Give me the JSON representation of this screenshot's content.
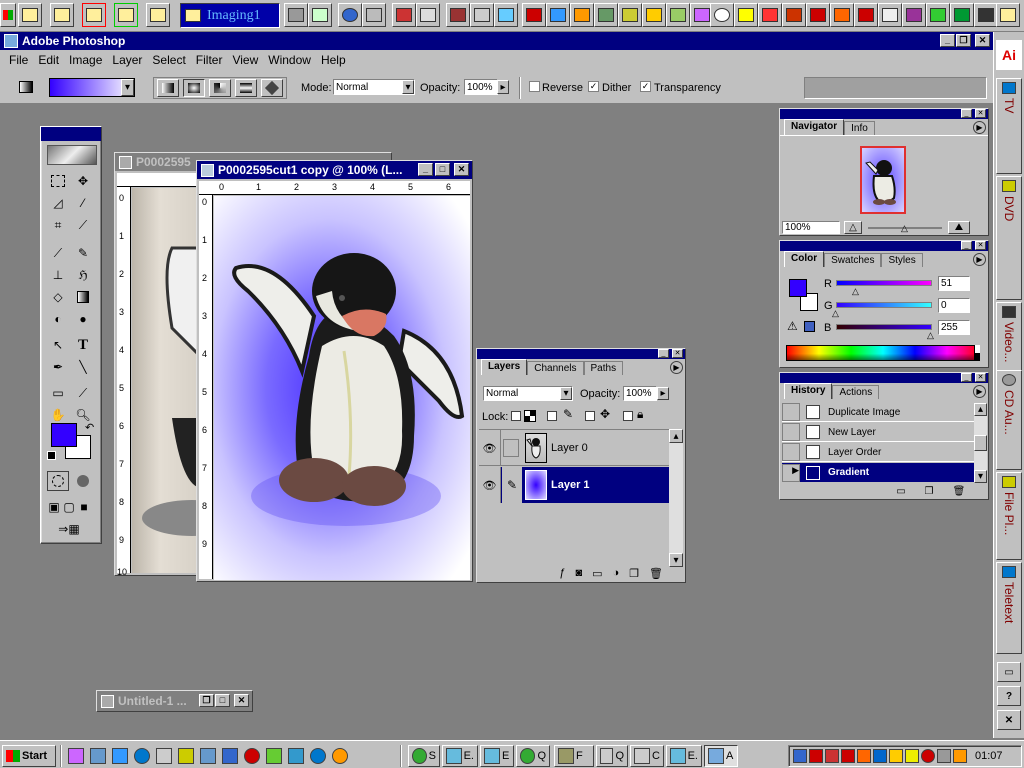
{
  "quickbar": {
    "imaging_task": "Imaging1"
  },
  "app": {
    "title": "Adobe Photoshop",
    "logo_text": "Ai"
  },
  "menu": [
    "File",
    "Edit",
    "Image",
    "Layer",
    "Select",
    "Filter",
    "View",
    "Window",
    "Help"
  ],
  "options": {
    "mode_label": "Mode:",
    "mode_value": "Normal",
    "opacity_label": "Opacity:",
    "opacity_value": "100%",
    "reverse_label": "Reverse",
    "dither_label": "Dither",
    "transparency_label": "Transparency",
    "reverse_checked": false,
    "dither_checked": true,
    "transparency_checked": true
  },
  "documents": {
    "back_title": "P0002595",
    "front_title": "P0002595cut1 copy @ 100% (L...",
    "ruler_top": [
      "0",
      "1",
      "2",
      "3",
      "4",
      "5",
      "6"
    ],
    "ruler_left": [
      "0",
      "1",
      "2",
      "3",
      "4",
      "5",
      "6",
      "7",
      "8",
      "9"
    ],
    "back_ruler_left": [
      "0",
      "1",
      "2",
      "3",
      "4",
      "5",
      "6",
      "7",
      "8",
      "9",
      "10"
    ],
    "minimized_title": "Untitled-1 ..."
  },
  "navigator": {
    "tabs": [
      "Navigator",
      "Info"
    ],
    "zoom": "100%"
  },
  "color": {
    "tabs": [
      "Color",
      "Swatches",
      "Styles"
    ],
    "r_label": "R",
    "g_label": "G",
    "b_label": "B",
    "r_value": "51",
    "g_value": "0",
    "b_value": "255",
    "foreground": "#3300ff",
    "background": "#ffffff"
  },
  "history": {
    "tabs": [
      "History",
      "Actions"
    ],
    "items": [
      "Duplicate Image",
      "New Layer",
      "Layer Order",
      "Gradient"
    ],
    "selected_index": 3
  },
  "layers": {
    "tabs": [
      "Layers",
      "Channels",
      "Paths"
    ],
    "blend_mode": "Normal",
    "opacity_label": "Opacity:",
    "opacity_value": "100%",
    "lock_label": "Lock:",
    "items": [
      "Layer 0",
      "Layer 1"
    ],
    "selected_index": 1
  },
  "sidebar": {
    "tabs": [
      "TV",
      "DVD",
      "Video...",
      "CD Au...",
      "File Pl...",
      "Teletext"
    ]
  },
  "taskbar": {
    "start": "Start",
    "buttons": [
      "S",
      "E.",
      "E",
      "Q",
      "F",
      "Q",
      "C",
      "E.",
      "A"
    ],
    "clock": "01:07"
  },
  "colors": {
    "titlebar": "#000080",
    "face": "#c0c0c0",
    "workspace": "#808080",
    "gradient_start": "#3300ff"
  }
}
